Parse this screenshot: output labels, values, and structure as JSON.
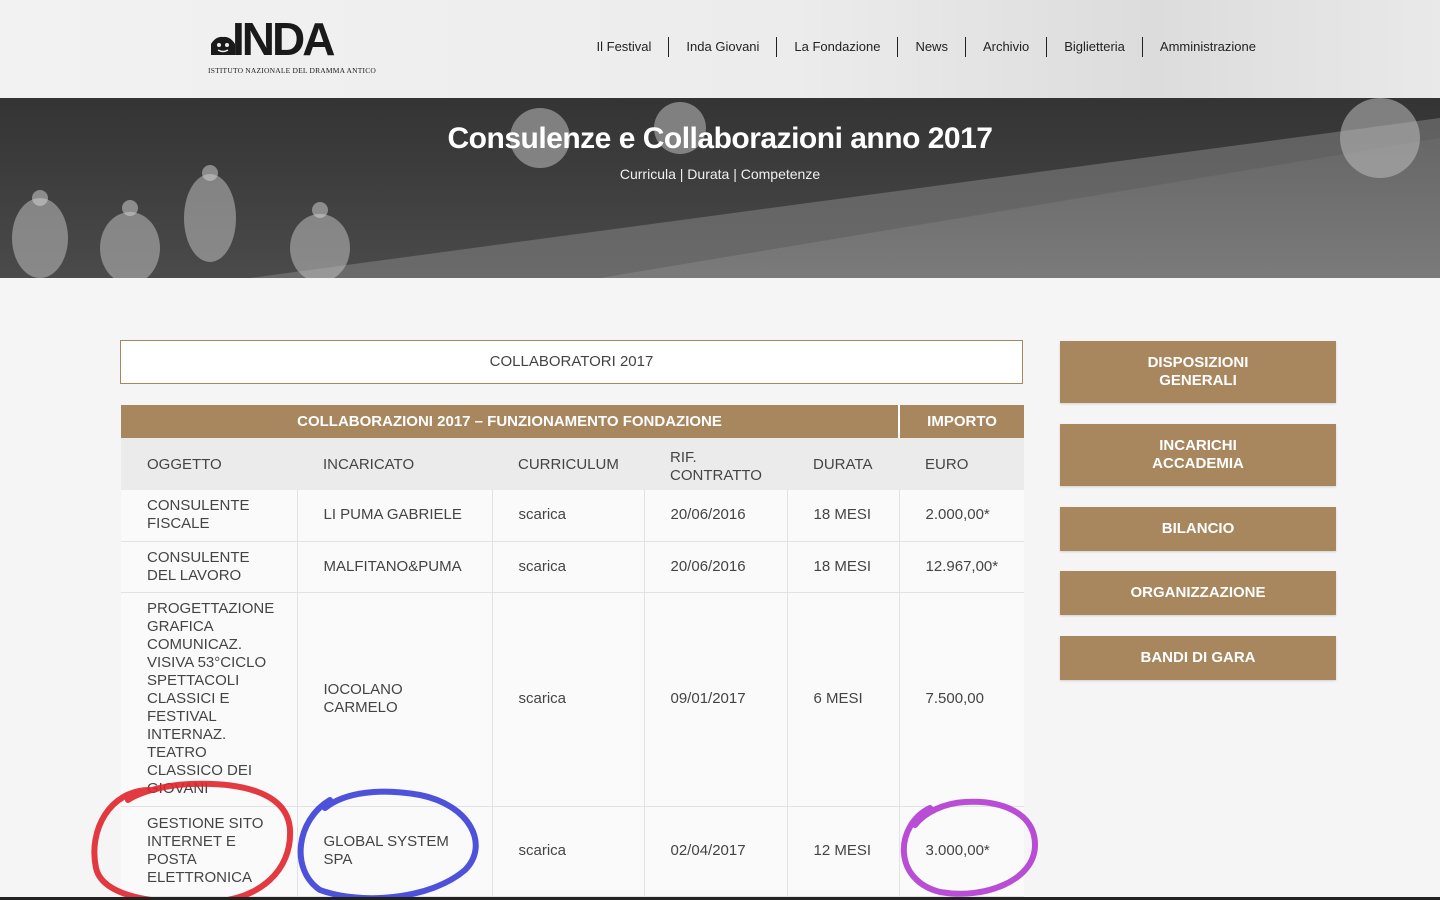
{
  "header": {
    "logo_text": "INDA",
    "logo_sub": "ISTITUTO NAZIONALE DEL DRAMMA ANTICO",
    "nav": [
      "Il Festival",
      "Inda Giovani",
      "La Fondazione",
      "News",
      "Archivio",
      "Biglietteria",
      "Amministrazione"
    ]
  },
  "banner": {
    "title": "Consulenze e Collaborazioni anno 2017",
    "subtitle": "Curricula | Durata | Competenze"
  },
  "section_title": "COLLABORATORI 2017",
  "table": {
    "group_header": "COLLABORAZIONI 2017 – FUNZIONAMENTO FONDAZIONE",
    "amount_header": "IMPORTO",
    "columns": [
      "OGGETTO",
      "INCARICATO",
      "CURRICULUM",
      "RIF. CONTRATTO",
      "DURATA",
      "EURO"
    ],
    "rows": [
      {
        "oggetto": "CONSULENTE FISCALE",
        "incaricato": "LI PUMA GABRIELE",
        "curriculum": "scarica",
        "rif": "20/06/2016",
        "durata": "18 MESI",
        "euro": "2.000,00*"
      },
      {
        "oggetto": "CONSULENTE DEL LAVORO",
        "incaricato": "MALFITANO&PUMA",
        "curriculum": "scarica",
        "rif": "20/06/2016",
        "durata": "18 MESI",
        "euro": "12.967,00*"
      },
      {
        "oggetto": "PROGETTAZIONE GRAFICA COMUNICAZ. VISIVA 53°CICLO SPETTACOLI CLASSICI E FESTIVAL INTERNAZ. TEATRO CLASSICO DEI GIOVANI",
        "incaricato": "IOCOLANO CARMELO",
        "curriculum": "scarica",
        "rif": "09/01/2017",
        "durata": "6 MESI",
        "euro": "7.500,00"
      },
      {
        "oggetto": "GESTIONE SITO INTERNET E POSTA ELETTRONICA",
        "incaricato": "GLOBAL SYSTEM SPA",
        "curriculum": "scarica",
        "rif": "02/04/2017",
        "durata": "12 MESI",
        "euro": "3.000,00*"
      }
    ]
  },
  "sidebar": {
    "buttons": [
      "DISPOSIZIONI GENERALI",
      "INCARICHI ACCADEMIA",
      "BILANCIO",
      "ORGANIZZAZIONE",
      "BANDI DI GARA"
    ]
  },
  "colors": {
    "accent": "#a8875f",
    "annotation_red": "#e0242b",
    "annotation_blue": "#3b3fd6",
    "annotation_purple": "#b13ad1"
  }
}
